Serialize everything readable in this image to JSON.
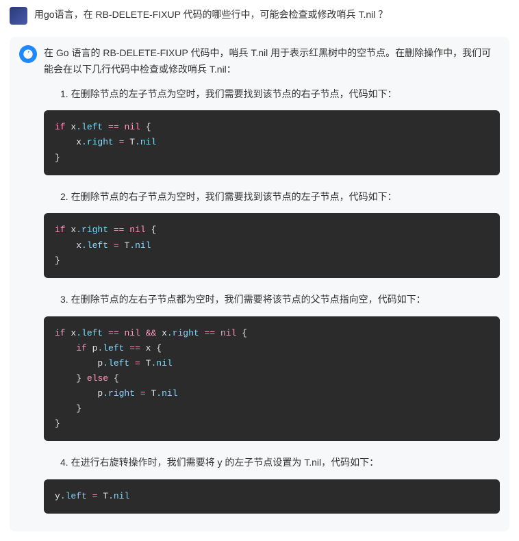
{
  "question": "用go语言，在 RB-DELETE-FIXUP 代码的哪些行中，可能会检查或修改哨兵 T.nil ？",
  "answer": {
    "intro": "在 Go 语言的 RB-DELETE-FIXUP 代码中，哨兵 T.nil 用于表示红黑树中的空节点。在删除操作中，我们可能会在以下几行代码中检查或修改哨兵 T.nil：",
    "items": [
      "1. 在删除节点的左子节点为空时，我们需要找到该节点的右子节点，代码如下：",
      "2. 在删除节点的右子节点为空时，我们需要找到该节点的左子节点，代码如下：",
      "3. 在删除节点的左右子节点都为空时，我们需要将该节点的父节点指向空，代码如下：",
      "4. 在进行右旋转操作时，我们需要将 y 的左子节点设置为 T.nil，代码如下："
    ],
    "code": [
      [
        {
          "t": "kw",
          "v": "if"
        },
        {
          "t": "var",
          "v": " x"
        },
        {
          "t": "prop",
          "v": ".left"
        },
        {
          "t": "var",
          "v": " "
        },
        {
          "t": "op",
          "v": "=="
        },
        {
          "t": "var",
          "v": " "
        },
        {
          "t": "kw",
          "v": "nil"
        },
        {
          "t": "var",
          "v": " "
        },
        {
          "t": "brace",
          "v": "{"
        },
        {
          "t": "nl"
        },
        {
          "t": "var",
          "v": "    x"
        },
        {
          "t": "prop",
          "v": ".right"
        },
        {
          "t": "var",
          "v": " "
        },
        {
          "t": "op",
          "v": "="
        },
        {
          "t": "var",
          "v": " T"
        },
        {
          "t": "prop",
          "v": ".nil"
        },
        {
          "t": "nl"
        },
        {
          "t": "brace",
          "v": "}"
        }
      ],
      [
        {
          "t": "kw",
          "v": "if"
        },
        {
          "t": "var",
          "v": " x"
        },
        {
          "t": "prop",
          "v": ".right"
        },
        {
          "t": "var",
          "v": " "
        },
        {
          "t": "op",
          "v": "=="
        },
        {
          "t": "var",
          "v": " "
        },
        {
          "t": "kw",
          "v": "nil"
        },
        {
          "t": "var",
          "v": " "
        },
        {
          "t": "brace",
          "v": "{"
        },
        {
          "t": "nl"
        },
        {
          "t": "var",
          "v": "    x"
        },
        {
          "t": "prop",
          "v": ".left"
        },
        {
          "t": "var",
          "v": " "
        },
        {
          "t": "op",
          "v": "="
        },
        {
          "t": "var",
          "v": " T"
        },
        {
          "t": "prop",
          "v": ".nil"
        },
        {
          "t": "nl"
        },
        {
          "t": "brace",
          "v": "}"
        }
      ],
      [
        {
          "t": "kw",
          "v": "if"
        },
        {
          "t": "var",
          "v": " x"
        },
        {
          "t": "prop",
          "v": ".left"
        },
        {
          "t": "var",
          "v": " "
        },
        {
          "t": "op",
          "v": "=="
        },
        {
          "t": "var",
          "v": " "
        },
        {
          "t": "kw",
          "v": "nil"
        },
        {
          "t": "var",
          "v": " "
        },
        {
          "t": "op",
          "v": "&&"
        },
        {
          "t": "var",
          "v": " x"
        },
        {
          "t": "prop",
          "v": ".right"
        },
        {
          "t": "var",
          "v": " "
        },
        {
          "t": "op",
          "v": "=="
        },
        {
          "t": "var",
          "v": " "
        },
        {
          "t": "kw",
          "v": "nil"
        },
        {
          "t": "var",
          "v": " "
        },
        {
          "t": "brace",
          "v": "{"
        },
        {
          "t": "nl"
        },
        {
          "t": "var",
          "v": "    "
        },
        {
          "t": "kw",
          "v": "if"
        },
        {
          "t": "var",
          "v": " p"
        },
        {
          "t": "prop",
          "v": ".left"
        },
        {
          "t": "var",
          "v": " "
        },
        {
          "t": "op",
          "v": "=="
        },
        {
          "t": "var",
          "v": " x "
        },
        {
          "t": "brace",
          "v": "{"
        },
        {
          "t": "nl"
        },
        {
          "t": "var",
          "v": "        p"
        },
        {
          "t": "prop",
          "v": ".left"
        },
        {
          "t": "var",
          "v": " "
        },
        {
          "t": "op",
          "v": "="
        },
        {
          "t": "var",
          "v": " T"
        },
        {
          "t": "prop",
          "v": ".nil"
        },
        {
          "t": "nl"
        },
        {
          "t": "var",
          "v": "    "
        },
        {
          "t": "brace",
          "v": "}"
        },
        {
          "t": "var",
          "v": " "
        },
        {
          "t": "kw",
          "v": "else"
        },
        {
          "t": "var",
          "v": " "
        },
        {
          "t": "brace",
          "v": "{"
        },
        {
          "t": "nl"
        },
        {
          "t": "var",
          "v": "        p"
        },
        {
          "t": "prop",
          "v": ".right"
        },
        {
          "t": "var",
          "v": " "
        },
        {
          "t": "op",
          "v": "="
        },
        {
          "t": "var",
          "v": " T"
        },
        {
          "t": "prop",
          "v": ".nil"
        },
        {
          "t": "nl"
        },
        {
          "t": "var",
          "v": "    "
        },
        {
          "t": "brace",
          "v": "}"
        },
        {
          "t": "nl"
        },
        {
          "t": "brace",
          "v": "}"
        }
      ],
      [
        {
          "t": "var",
          "v": "y"
        },
        {
          "t": "prop",
          "v": ".left"
        },
        {
          "t": "var",
          "v": " "
        },
        {
          "t": "op",
          "v": "="
        },
        {
          "t": "var",
          "v": " T"
        },
        {
          "t": "prop",
          "v": ".nil"
        }
      ]
    ]
  }
}
